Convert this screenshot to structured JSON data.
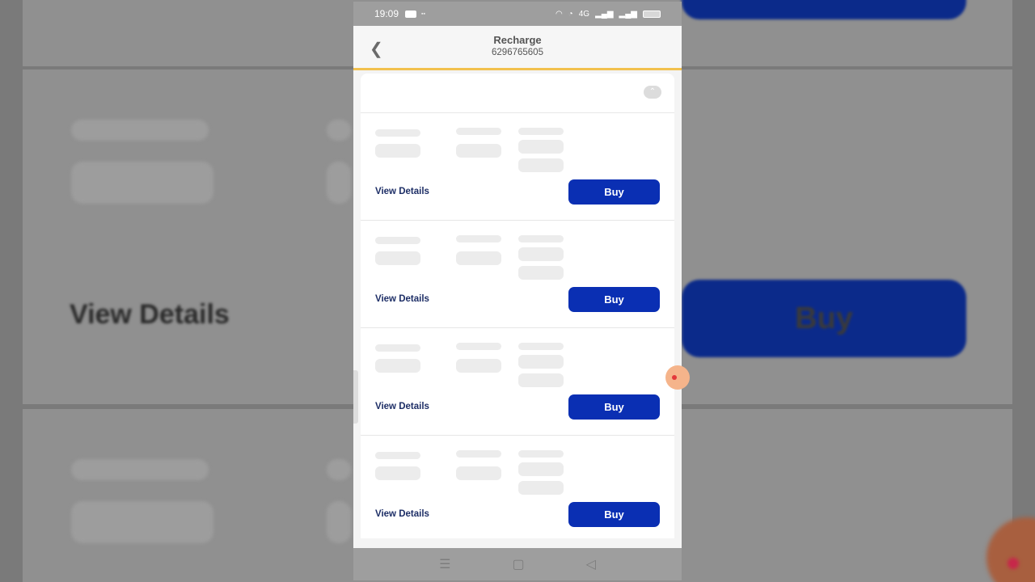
{
  "status_bar": {
    "time": "19:09",
    "network_label": "4G",
    "battery_label": "80"
  },
  "header": {
    "title": "Recharge",
    "subtitle": "6296765605",
    "back_icon": "chevron-left-icon"
  },
  "collapse_icon": "chevron-up-icon",
  "plans": [
    {
      "view_details_label": "View Details",
      "buy_label": "Buy"
    },
    {
      "view_details_label": "View Details",
      "buy_label": "Buy"
    },
    {
      "view_details_label": "View Details",
      "buy_label": "Buy"
    },
    {
      "view_details_label": "View Details",
      "buy_label": "Buy"
    }
  ],
  "background_zoom": {
    "view_details_label": "View Details",
    "buy_label": "Buy"
  },
  "nav_bar": {
    "menu_icon": "☰",
    "home_icon": "▢",
    "back_icon": "◁"
  },
  "colors": {
    "accent": "#0a2fb3",
    "header_underline": "#f2c14e",
    "link_text": "#1d2e66"
  }
}
